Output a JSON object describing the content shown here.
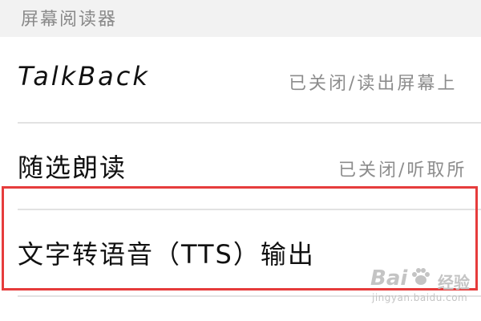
{
  "section": {
    "title": "屏幕阅读器"
  },
  "items": [
    {
      "title": "TalkBack",
      "subtitle": "已关闭/读出屏幕上"
    },
    {
      "title": "随选朗读",
      "subtitle": "已关闭/听取所"
    },
    {
      "title": "文字转语音（TTS）输出",
      "subtitle": ""
    }
  ],
  "highlight": {
    "color": "#e63c3c"
  },
  "watermark": {
    "name": "Bai",
    "suffix": "经验",
    "url": "jingyan.baidu.com"
  }
}
